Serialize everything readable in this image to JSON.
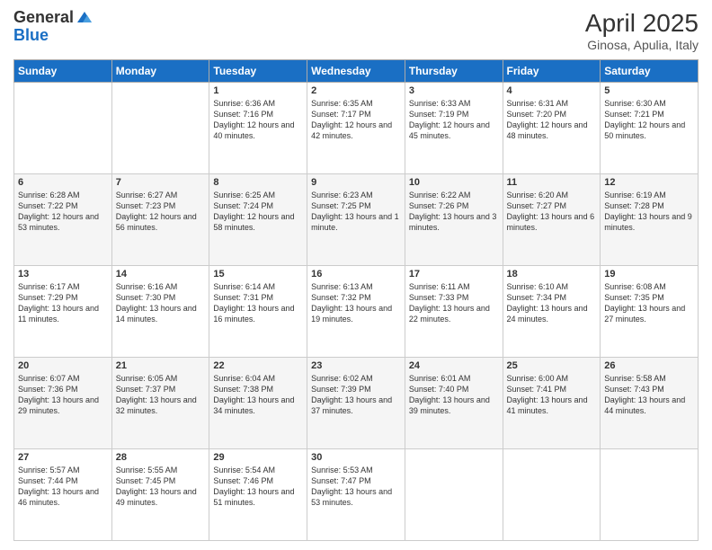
{
  "header": {
    "logo_general": "General",
    "logo_blue": "Blue",
    "title": "April 2025",
    "subtitle": "Ginosa, Apulia, Italy"
  },
  "days_of_week": [
    "Sunday",
    "Monday",
    "Tuesday",
    "Wednesday",
    "Thursday",
    "Friday",
    "Saturday"
  ],
  "weeks": [
    [
      {
        "day": "",
        "info": ""
      },
      {
        "day": "",
        "info": ""
      },
      {
        "day": "1",
        "info": "Sunrise: 6:36 AM\nSunset: 7:16 PM\nDaylight: 12 hours and 40 minutes."
      },
      {
        "day": "2",
        "info": "Sunrise: 6:35 AM\nSunset: 7:17 PM\nDaylight: 12 hours and 42 minutes."
      },
      {
        "day": "3",
        "info": "Sunrise: 6:33 AM\nSunset: 7:19 PM\nDaylight: 12 hours and 45 minutes."
      },
      {
        "day": "4",
        "info": "Sunrise: 6:31 AM\nSunset: 7:20 PM\nDaylight: 12 hours and 48 minutes."
      },
      {
        "day": "5",
        "info": "Sunrise: 6:30 AM\nSunset: 7:21 PM\nDaylight: 12 hours and 50 minutes."
      }
    ],
    [
      {
        "day": "6",
        "info": "Sunrise: 6:28 AM\nSunset: 7:22 PM\nDaylight: 12 hours and 53 minutes."
      },
      {
        "day": "7",
        "info": "Sunrise: 6:27 AM\nSunset: 7:23 PM\nDaylight: 12 hours and 56 minutes."
      },
      {
        "day": "8",
        "info": "Sunrise: 6:25 AM\nSunset: 7:24 PM\nDaylight: 12 hours and 58 minutes."
      },
      {
        "day": "9",
        "info": "Sunrise: 6:23 AM\nSunset: 7:25 PM\nDaylight: 13 hours and 1 minute."
      },
      {
        "day": "10",
        "info": "Sunrise: 6:22 AM\nSunset: 7:26 PM\nDaylight: 13 hours and 3 minutes."
      },
      {
        "day": "11",
        "info": "Sunrise: 6:20 AM\nSunset: 7:27 PM\nDaylight: 13 hours and 6 minutes."
      },
      {
        "day": "12",
        "info": "Sunrise: 6:19 AM\nSunset: 7:28 PM\nDaylight: 13 hours and 9 minutes."
      }
    ],
    [
      {
        "day": "13",
        "info": "Sunrise: 6:17 AM\nSunset: 7:29 PM\nDaylight: 13 hours and 11 minutes."
      },
      {
        "day": "14",
        "info": "Sunrise: 6:16 AM\nSunset: 7:30 PM\nDaylight: 13 hours and 14 minutes."
      },
      {
        "day": "15",
        "info": "Sunrise: 6:14 AM\nSunset: 7:31 PM\nDaylight: 13 hours and 16 minutes."
      },
      {
        "day": "16",
        "info": "Sunrise: 6:13 AM\nSunset: 7:32 PM\nDaylight: 13 hours and 19 minutes."
      },
      {
        "day": "17",
        "info": "Sunrise: 6:11 AM\nSunset: 7:33 PM\nDaylight: 13 hours and 22 minutes."
      },
      {
        "day": "18",
        "info": "Sunrise: 6:10 AM\nSunset: 7:34 PM\nDaylight: 13 hours and 24 minutes."
      },
      {
        "day": "19",
        "info": "Sunrise: 6:08 AM\nSunset: 7:35 PM\nDaylight: 13 hours and 27 minutes."
      }
    ],
    [
      {
        "day": "20",
        "info": "Sunrise: 6:07 AM\nSunset: 7:36 PM\nDaylight: 13 hours and 29 minutes."
      },
      {
        "day": "21",
        "info": "Sunrise: 6:05 AM\nSunset: 7:37 PM\nDaylight: 13 hours and 32 minutes."
      },
      {
        "day": "22",
        "info": "Sunrise: 6:04 AM\nSunset: 7:38 PM\nDaylight: 13 hours and 34 minutes."
      },
      {
        "day": "23",
        "info": "Sunrise: 6:02 AM\nSunset: 7:39 PM\nDaylight: 13 hours and 37 minutes."
      },
      {
        "day": "24",
        "info": "Sunrise: 6:01 AM\nSunset: 7:40 PM\nDaylight: 13 hours and 39 minutes."
      },
      {
        "day": "25",
        "info": "Sunrise: 6:00 AM\nSunset: 7:41 PM\nDaylight: 13 hours and 41 minutes."
      },
      {
        "day": "26",
        "info": "Sunrise: 5:58 AM\nSunset: 7:43 PM\nDaylight: 13 hours and 44 minutes."
      }
    ],
    [
      {
        "day": "27",
        "info": "Sunrise: 5:57 AM\nSunset: 7:44 PM\nDaylight: 13 hours and 46 minutes."
      },
      {
        "day": "28",
        "info": "Sunrise: 5:55 AM\nSunset: 7:45 PM\nDaylight: 13 hours and 49 minutes."
      },
      {
        "day": "29",
        "info": "Sunrise: 5:54 AM\nSunset: 7:46 PM\nDaylight: 13 hours and 51 minutes."
      },
      {
        "day": "30",
        "info": "Sunrise: 5:53 AM\nSunset: 7:47 PM\nDaylight: 13 hours and 53 minutes."
      },
      {
        "day": "",
        "info": ""
      },
      {
        "day": "",
        "info": ""
      },
      {
        "day": "",
        "info": ""
      }
    ]
  ]
}
